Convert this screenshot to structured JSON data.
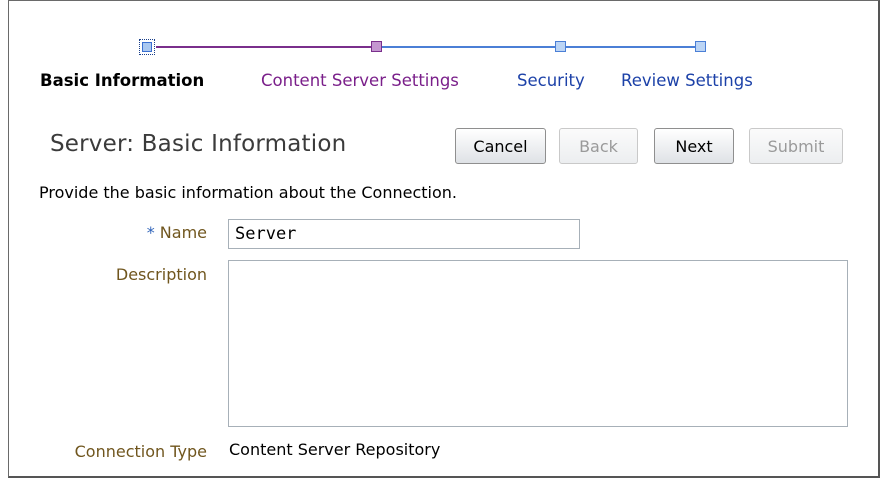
{
  "train": {
    "steps": [
      {
        "label": "Basic Information",
        "state": "current"
      },
      {
        "label": "Content Server Settings",
        "state": "visited"
      },
      {
        "label": "Security",
        "state": "unvisited"
      },
      {
        "label": "Review Settings",
        "state": "unvisited"
      }
    ],
    "colors": {
      "current": "#000000",
      "visited": "#7a1f8a",
      "unvisited": "#1c41a8"
    }
  },
  "page": {
    "title": "Server: Basic Information",
    "instructions": "Provide the basic information about the Connection."
  },
  "buttons": {
    "cancel": "Cancel",
    "back": "Back",
    "next": "Next",
    "submit": "Submit"
  },
  "form": {
    "name": {
      "label": "Name",
      "required_marker": "*",
      "value": "Server"
    },
    "description": {
      "label": "Description",
      "value": ""
    },
    "connection_type": {
      "label": "Connection Type",
      "value": "Content Server Repository"
    }
  }
}
